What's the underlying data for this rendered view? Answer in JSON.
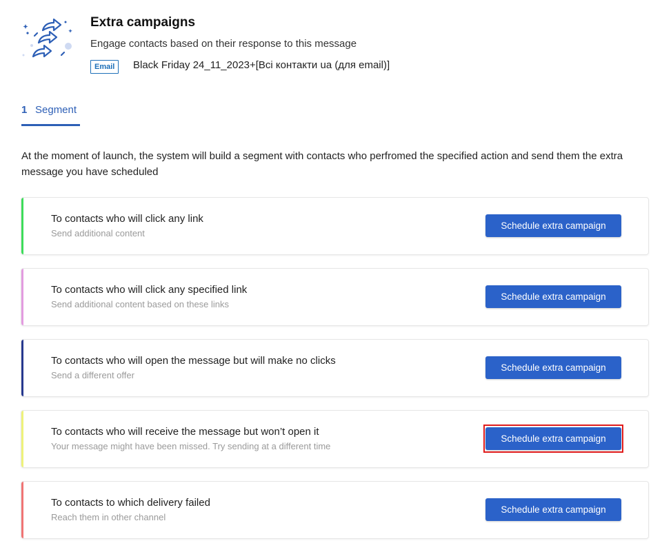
{
  "header": {
    "title": "Extra campaigns",
    "subtitle": "Engage contacts based on their response to this message",
    "channel_badge": "Email",
    "campaign_name": "Black Friday 24_11_2023+[Всі контакти ua (для email)]",
    "logo_icon": "share-arrows-icon"
  },
  "tabs": [
    {
      "number": "1",
      "label": "Segment"
    }
  ],
  "description": "At the moment of launch, the system will build a segment with contacts who perfromed the specified action and send them the extra message you have scheduled",
  "cards": [
    {
      "title": "To contacts who will click any link",
      "subtitle": "Send additional content",
      "button": "Schedule extra campaign",
      "accent": "#3ddc5a"
    },
    {
      "title": "To contacts who will click any specified link",
      "subtitle": "Send additional content based on these links",
      "button": "Schedule extra campaign",
      "accent": "#e39be0"
    },
    {
      "title": "To contacts who will open the message but will make no clicks",
      "subtitle": "Send a different offer",
      "button": "Schedule extra campaign",
      "accent": "#27398f"
    },
    {
      "title": "To contacts who will receive the message but won’t open it",
      "subtitle": "Your message might have been missed. Try sending at a different time",
      "button": "Schedule extra campaign",
      "accent": "#eef27a"
    },
    {
      "title": "To contacts to which delivery failed",
      "subtitle": "Reach them in other channel",
      "button": "Schedule extra campaign",
      "accent": "#f07474"
    }
  ],
  "colors": {
    "primary": "#2b62c9",
    "tab_active": "#2d5fb6",
    "badge": "#1d6fb8",
    "highlight": "#e01b1b"
  }
}
